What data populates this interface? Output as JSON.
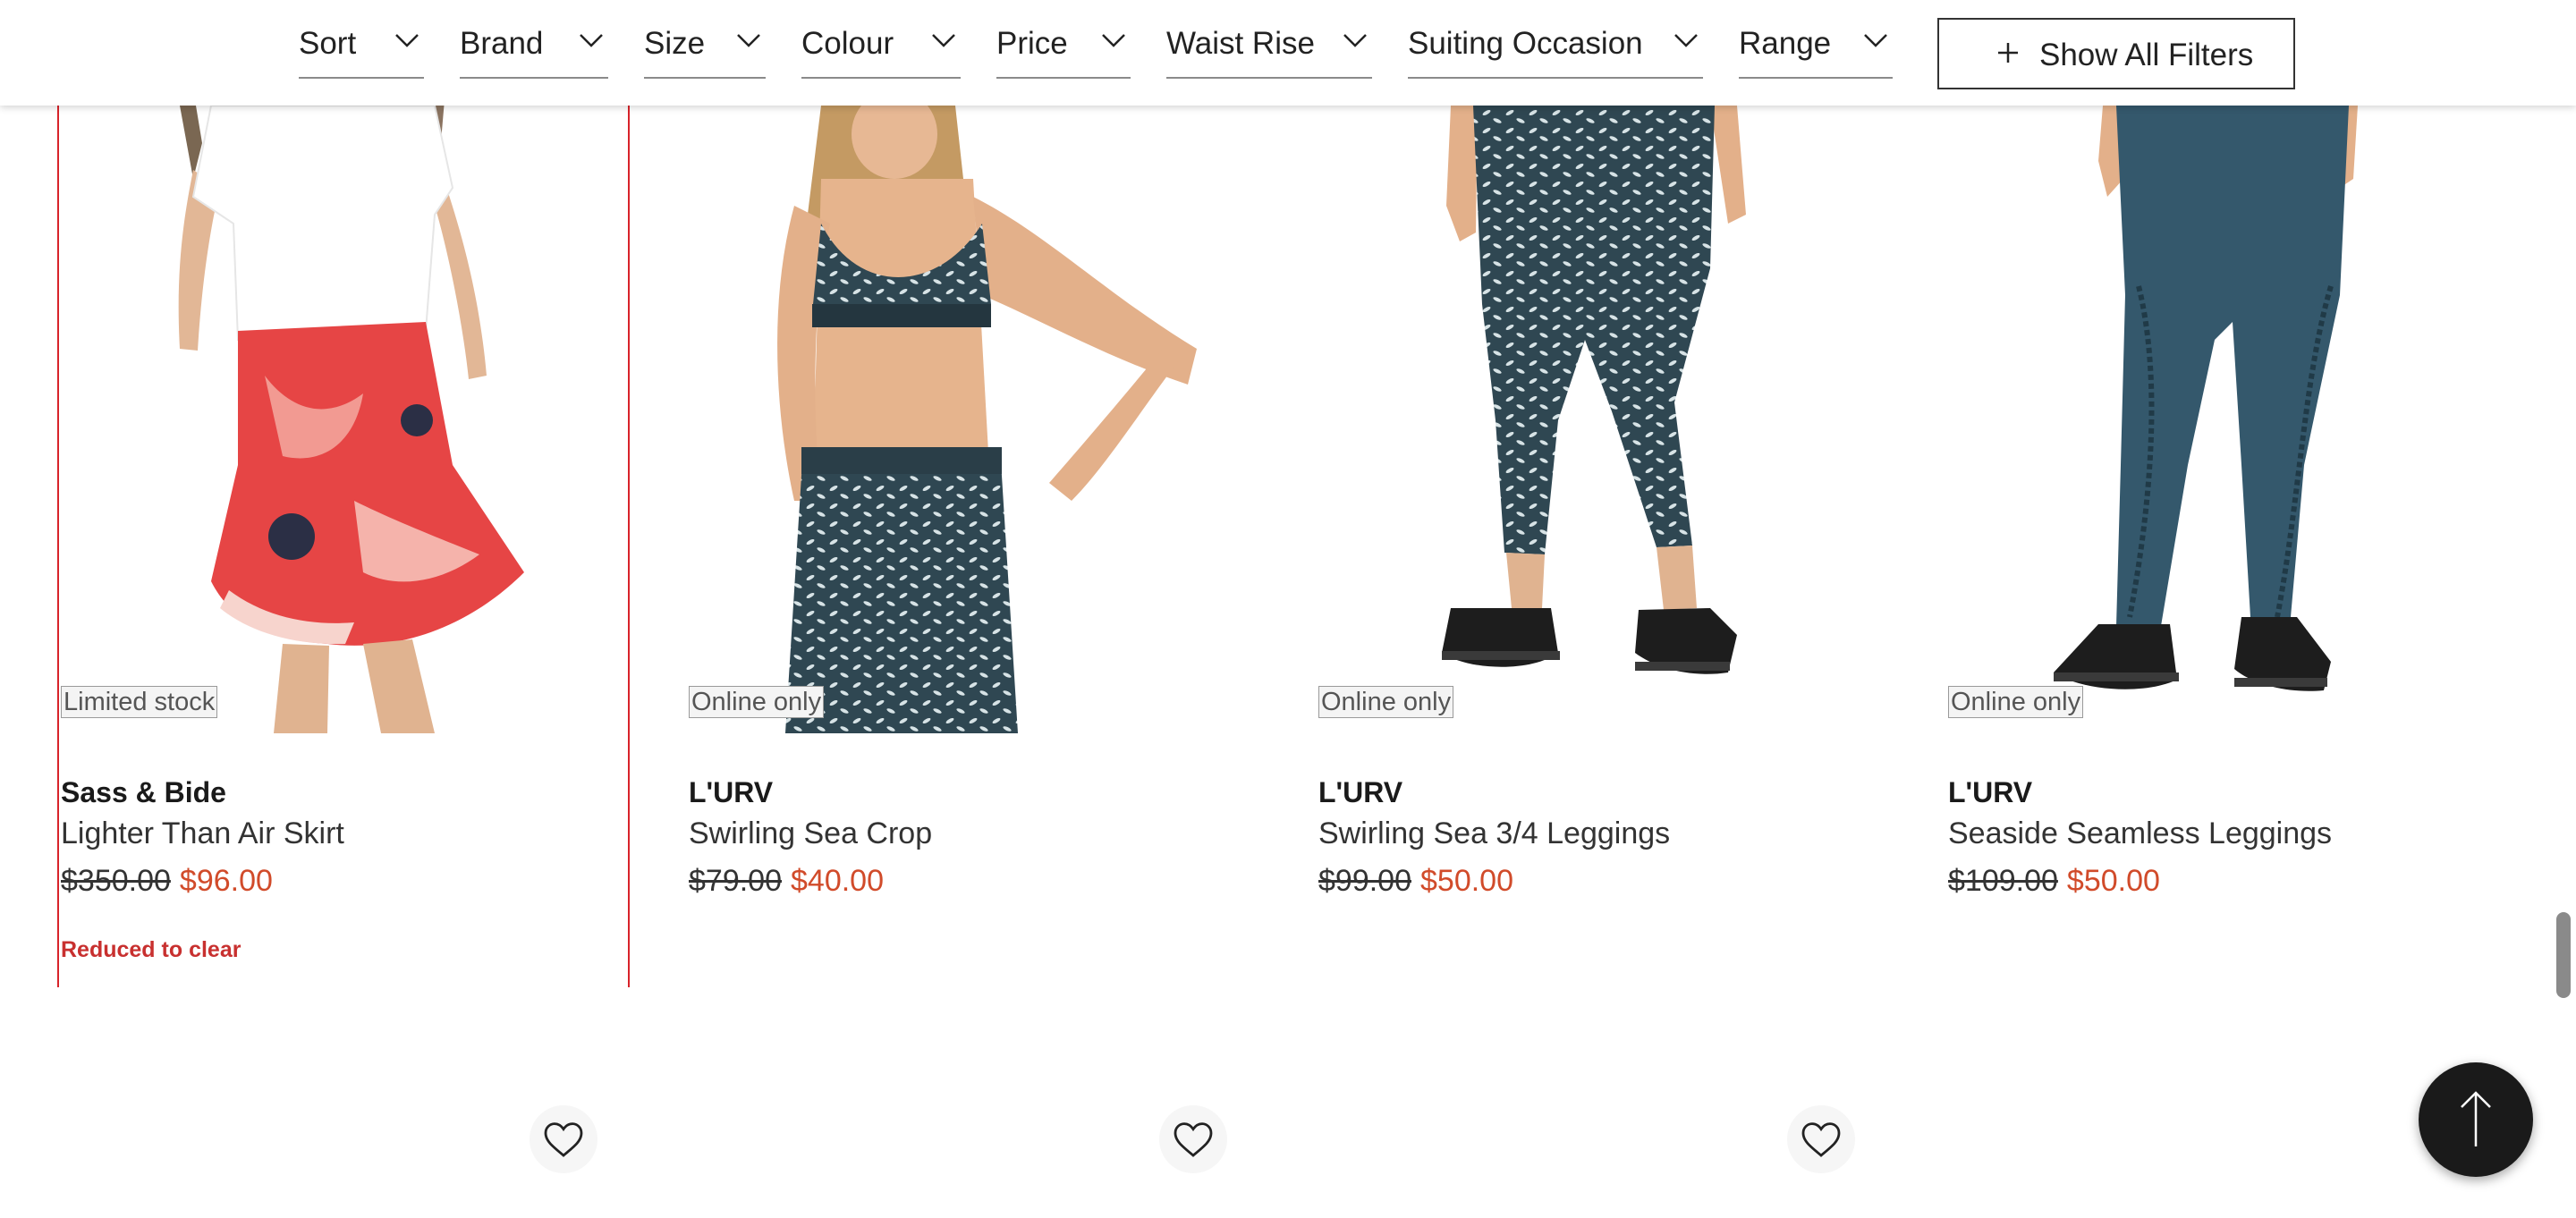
{
  "filters": [
    {
      "label": "Sort"
    },
    {
      "label": "Brand"
    },
    {
      "label": "Size"
    },
    {
      "label": "Colour"
    },
    {
      "label": "Price"
    },
    {
      "label": "Waist Rise"
    },
    {
      "label": "Suiting Occasion"
    },
    {
      "label": "Range"
    }
  ],
  "show_all_filters": {
    "label": "Show All Filters",
    "icon": "plus-icon"
  },
  "products": [
    {
      "badge": "Limited stock",
      "brand": "Sass & Bide",
      "name": "Lighter Than Air Skirt",
      "was_price": "$350.00",
      "now_price": "$96.00",
      "note": "Reduced to clear"
    },
    {
      "badge": "Online only",
      "brand": "L'URV",
      "name": "Swirling Sea Crop",
      "was_price": "$79.00",
      "now_price": "$40.00"
    },
    {
      "badge": "Online only",
      "brand": "L'URV",
      "name": "Swirling Sea 3/4 Leggings",
      "was_price": "$99.00",
      "now_price": "$50.00"
    },
    {
      "badge": "Online only",
      "brand": "L'URV",
      "name": "Seaside Seamless Leggings",
      "was_price": "$109.00",
      "now_price": "$50.00"
    }
  ],
  "colors": {
    "sale_price": "#d14b2a",
    "clear_note": "#c8302f",
    "highlight_border": "#d8232a",
    "back_to_top_bg": "#1a1a1a"
  },
  "icons": {
    "filter_toggle": "chevron-down-icon",
    "wishlist": "heart-icon",
    "back_to_top": "arrow-up-icon"
  }
}
